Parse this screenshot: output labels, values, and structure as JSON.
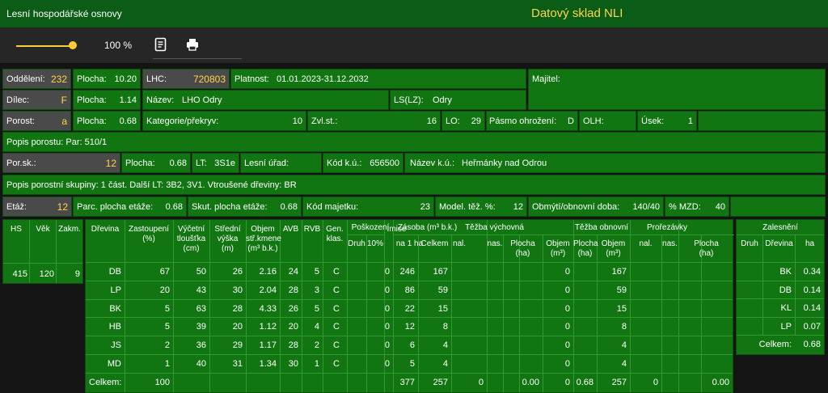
{
  "app": {
    "title": "Lesní hospodářské osnovy",
    "brand": "Datový sklad NLI"
  },
  "toolbar": {
    "zoom": "100 %",
    "zoom_level": 1.0,
    "notes_icon": "notes-icon",
    "print_icon": "printer-icon"
  },
  "colors": {
    "header_bg": "#0b5c16",
    "cell_bg": "#117611",
    "label_bg": "#4a4a4a",
    "accent": "#ffd54a"
  },
  "form": {
    "oddeleni_label": "Oddělení:",
    "oddeleni": "232",
    "plocha1_label": "Plocha:",
    "plocha1": "10.20",
    "lhc_label": "LHC:",
    "lhc": "720803",
    "platnost_label": "Platnost:",
    "platnost": "01.01.2023-31.12.2032",
    "majitel_label": "Majitel:",
    "dilec_label": "Dílec:",
    "dilec": "F",
    "plocha2_label": "Plocha:",
    "plocha2": "1.14",
    "nazev_label": "Název:",
    "nazev": "LHO Odry",
    "lslz_label": "LS(LZ):",
    "lslz": "Odry",
    "porost_label": "Porost:",
    "porost": "a",
    "plocha3_label": "Plocha:",
    "plocha3": "0.68",
    "kategorie_label": "Kategorie/překryv:",
    "kategorie": "10",
    "zvlst_label": "Zvl.st.:",
    "zvlst": "16",
    "lo_label": "LO:",
    "lo": "29",
    "pasmo_label": "Pásmo ohrožení:",
    "pasmo": "D",
    "olh_label": "OLH:",
    "usek_label": "Úsek:",
    "usek": "1",
    "popis_porostu": "Popis porostu:  Par: 510/1",
    "porsk_label": "Por.sk.:",
    "porsk": "12",
    "plocha4_label": "Plocha:",
    "plocha4": "0.68",
    "lt_label": "LT:",
    "lt": "3S1e",
    "lesni_urad_label": "Lesní úřad:",
    "kodku_label": "Kód k.ú.:",
    "kodku": "656500",
    "nazevku_label": "Název k.ú.:",
    "nazevku": "Heřmánky nad Odrou",
    "popis_skupiny": "Popis porostní skupiny:  1 část. Další LT: 3B2, 3V1. Vtroušené dřeviny: BR",
    "etaz_label": "Etáž:",
    "etaz": "12",
    "parc_label": "Parc. plocha etáže:",
    "parc": "0.68",
    "skut_label": "Skut. plocha etáže:",
    "skut": "0.68",
    "kodmaj_label": "Kód majetku:",
    "kodmaj": "23",
    "model_label": "Model. těž. %:",
    "model": "12",
    "obmyti_label": "Obmýtí/obnovní doba:",
    "obmyti": "140/40",
    "mzd_label": "% MZD:",
    "mzd": "40"
  },
  "hs": {
    "headers": [
      "HS",
      "Věk",
      "Zakm."
    ],
    "values": [
      "415",
      "120",
      "9"
    ]
  },
  "main": {
    "headers": {
      "drevina": "Dřevina",
      "zastoupeni": "Zastoupení\n(%)",
      "vyctlo": "Výčetní\ntloušťka\n(cm)",
      "stredni": "Střední\nvýška\n(m)",
      "objem": "Objem\nstř.kmene\n(m³ b.k.)",
      "avb": "AVB",
      "rvb": "RVB",
      "gen": "Gen.\nklas.",
      "poskozeni": "Poškození",
      "druh": "Druh",
      "proc10": "10%",
      "imise": "Imise",
      "zasoba": "Zásoba (m³ b.k.)",
      "na1ha": "na 1 ha",
      "celkem": "Celkem",
      "tezbavych": "Těžba výchovná",
      "nal": "nal.",
      "nas": "nas.",
      "plochaha": "Plocha\n(ha)",
      "objemm3": "Objem\n(m³)",
      "tezbaobn": "Těžba obnovní",
      "prorezavky": "Prořezávky"
    },
    "rows": [
      {
        "d": "DB",
        "z": "67",
        "v": "50",
        "s": "26",
        "o": "2.16",
        "a": "24",
        "r": "5",
        "g": "C",
        "i": "0",
        "n": "246",
        "c": "167",
        "tvo": "0",
        "too": "167"
      },
      {
        "d": "LP",
        "z": "20",
        "v": "43",
        "s": "30",
        "o": "2.04",
        "a": "28",
        "r": "3",
        "g": "C",
        "i": "0",
        "n": "86",
        "c": "59",
        "tvo": "0",
        "too": "59"
      },
      {
        "d": "BK",
        "z": "5",
        "v": "63",
        "s": "28",
        "o": "4.33",
        "a": "26",
        "r": "5",
        "g": "C",
        "i": "0",
        "n": "22",
        "c": "15",
        "tvo": "0",
        "too": "15"
      },
      {
        "d": "HB",
        "z": "5",
        "v": "39",
        "s": "20",
        "o": "1.12",
        "a": "20",
        "r": "4",
        "g": "C",
        "i": "0",
        "n": "12",
        "c": "8",
        "tvo": "0",
        "too": "8"
      },
      {
        "d": "JS",
        "z": "2",
        "v": "36",
        "s": "29",
        "o": "1.17",
        "a": "28",
        "r": "2",
        "g": "C",
        "i": "0",
        "n": "6",
        "c": "4",
        "tvo": "0",
        "too": "4"
      },
      {
        "d": "MD",
        "z": "1",
        "v": "40",
        "s": "31",
        "o": "1.34",
        "a": "30",
        "r": "1",
        "g": "C",
        "i": "0",
        "n": "5",
        "c": "4",
        "tvo": "0",
        "too": "4"
      }
    ],
    "total": {
      "label": "Celkem:",
      "z": "100",
      "n": "377",
      "c": "257",
      "tv_nal": "0",
      "tv_plocha": "0.00",
      "tv_objem": "0",
      "to_plocha": "0.68",
      "to_objem": "257",
      "pr_nal": "0",
      "pr_plocha": "0.00"
    }
  },
  "zalesneni": {
    "title": "Zalesnění",
    "headers": [
      "Druh",
      "Dřevina",
      "ha"
    ],
    "rows": [
      {
        "d": "BK",
        "ha": "0.34"
      },
      {
        "d": "DB",
        "ha": "0.14"
      },
      {
        "d": "KL",
        "ha": "0.14"
      },
      {
        "d": "LP",
        "ha": "0.07"
      }
    ],
    "total_label": "Celkem:",
    "total": "0.68"
  }
}
